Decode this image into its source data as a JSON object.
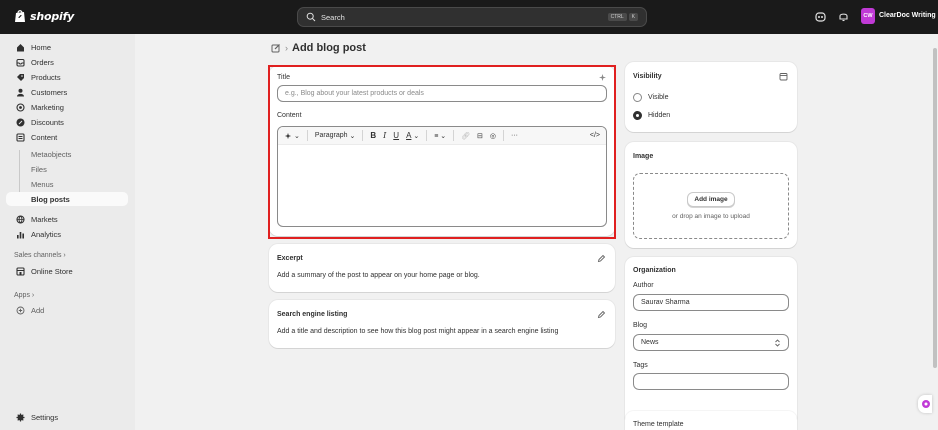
{
  "topbar": {
    "brand": "shopify",
    "search_placeholder": "Search",
    "shortcut_ctrl": "CTRL",
    "shortcut_key": "K",
    "store_initials": "CW",
    "store_name": "ClearDoc Writing"
  },
  "sidebar": {
    "items": [
      {
        "label": "Home",
        "icon": "home-icon"
      },
      {
        "label": "Orders",
        "icon": "inbox-icon"
      },
      {
        "label": "Products",
        "icon": "tag-icon"
      },
      {
        "label": "Customers",
        "icon": "person-icon"
      },
      {
        "label": "Marketing",
        "icon": "target-icon"
      },
      {
        "label": "Discounts",
        "icon": "discount-icon"
      },
      {
        "label": "Content",
        "icon": "content-icon"
      }
    ],
    "content_sub": [
      "Metaobjects",
      "Files",
      "Menus",
      "Blog posts"
    ],
    "items2": [
      {
        "label": "Markets",
        "icon": "globe-icon"
      },
      {
        "label": "Analytics",
        "icon": "bar-chart-icon"
      }
    ],
    "sales_channels": "Sales channels",
    "online_store": "Online Store",
    "apps": "Apps",
    "add": "Add",
    "settings": "Settings"
  },
  "page": {
    "title": "Add blog post"
  },
  "post_card": {
    "title_label": "Title",
    "title_placeholder": "e.g., Blog about your latest products or deals",
    "content_label": "Content",
    "paragraph": "Paragraph",
    "bold": "B",
    "italic": "I",
    "underline": "U",
    "text_color": "A",
    "more": "···",
    "code": "</>"
  },
  "excerpt": {
    "title": "Excerpt",
    "help": "Add a summary of the post to appear on your home page or blog."
  },
  "seo": {
    "title": "Search engine listing",
    "help": "Add a title and description to see how this blog post might appear in a search engine listing"
  },
  "visibility": {
    "title": "Visibility",
    "options": [
      "Visible",
      "Hidden"
    ],
    "selected": "Hidden"
  },
  "image": {
    "title": "Image",
    "button": "Add image",
    "hint": "or drop an image to upload"
  },
  "organization": {
    "title": "Organization",
    "author_label": "Author",
    "author_value": "Saurav Sharma",
    "blog_label": "Blog",
    "blog_value": "News",
    "tags_label": "Tags",
    "tags_value": ""
  },
  "theme": {
    "title": "Theme template"
  },
  "colors": {
    "topbar": "#1a1a1a",
    "highlight": "#e02020",
    "store_badge": "#c03ad6"
  }
}
